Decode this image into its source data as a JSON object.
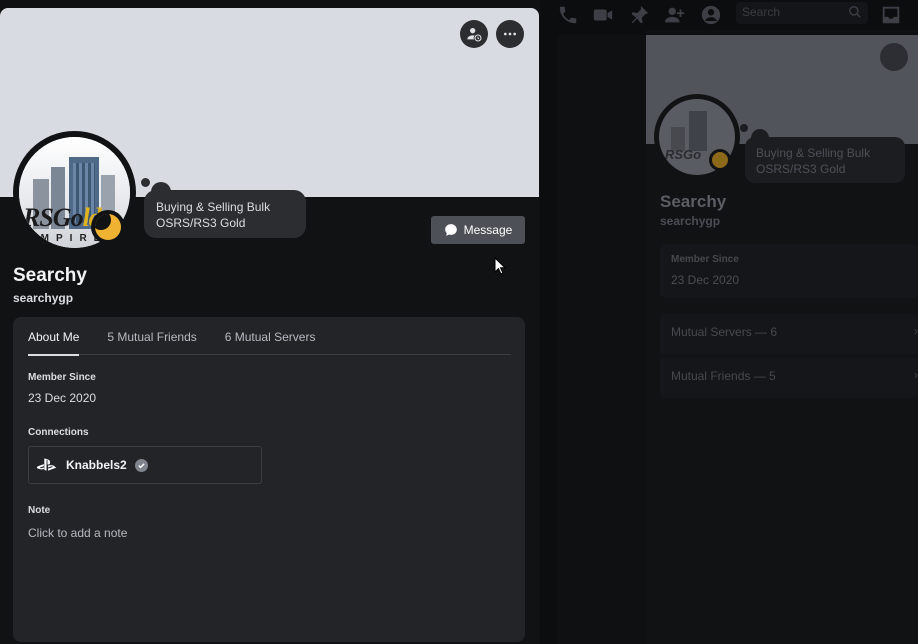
{
  "background": {
    "search_placeholder": "Search",
    "bubble_text": "Buying & Selling Bulk OSRS/RS3 Gold",
    "display_name": "Searchy",
    "username": "searchygp",
    "member_since_label": "Member Since",
    "member_since_value": "23 Dec 2020",
    "mutual_servers_row": "Mutual Servers — 6",
    "mutual_friends_row": "Mutual Friends — 5"
  },
  "profile": {
    "display_name": "Searchy",
    "username": "searchygp",
    "custom_status": "Buying & Selling Bulk OSRS/RS3 Gold",
    "avatar_logo": "RSGold",
    "avatar_sub": "EMPIRE",
    "banner_color": "#d8dbe1",
    "status_color": "#f0b232",
    "message_button": "Message"
  },
  "tabs": [
    {
      "label": "About Me",
      "active": true
    },
    {
      "label": "5 Mutual Friends",
      "active": false
    },
    {
      "label": "6 Mutual Servers",
      "active": false
    }
  ],
  "about": {
    "member_since_label": "Member Since",
    "member_since_value": "23 Dec 2020",
    "connections_label": "Connections",
    "connection_name": "Knabbels2",
    "connection_icon": "playstation-icon",
    "note_label": "Note",
    "note_placeholder": "Click to add a note"
  }
}
